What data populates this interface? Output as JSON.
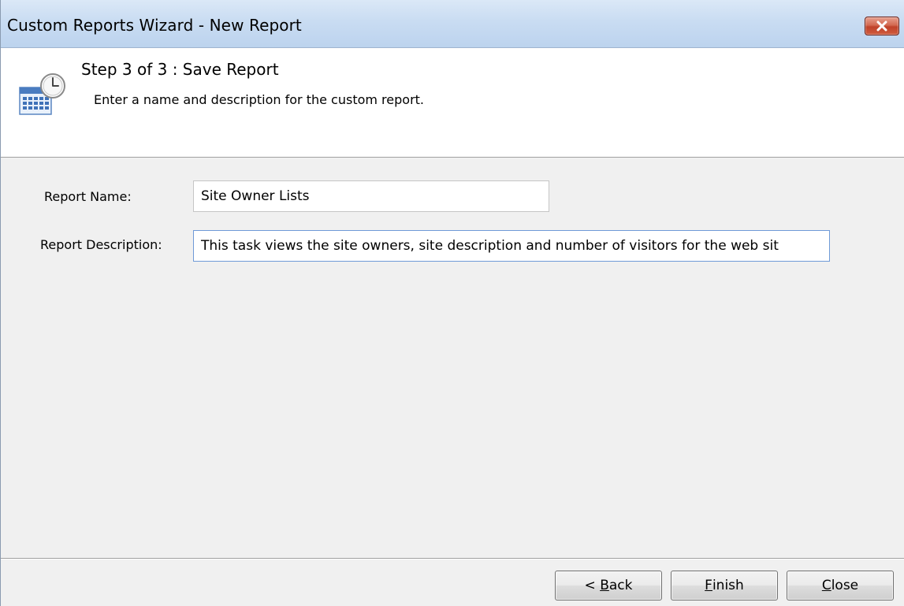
{
  "window": {
    "title": "Custom Reports Wizard - New Report",
    "close_icon": "close-icon",
    "close_color": "#c7452c"
  },
  "header": {
    "icon": "calendar-clock-icon",
    "step_title": "Step 3 of 3 : Save Report",
    "step_description": "Enter a name and description for the custom report."
  },
  "form": {
    "report_name": {
      "label": "Report Name:",
      "value": "Site Owner Lists"
    },
    "report_description": {
      "label": "Report Description:",
      "value": "This task views the site owners, site description and number of visitors for the web sit"
    }
  },
  "buttons": {
    "back": {
      "prefix": "< ",
      "mnemonic": "B",
      "rest": "ack"
    },
    "finish": {
      "prefix": "",
      "mnemonic": "F",
      "rest": "inish"
    },
    "close": {
      "prefix": "",
      "mnemonic": "C",
      "rest": "lose"
    }
  }
}
